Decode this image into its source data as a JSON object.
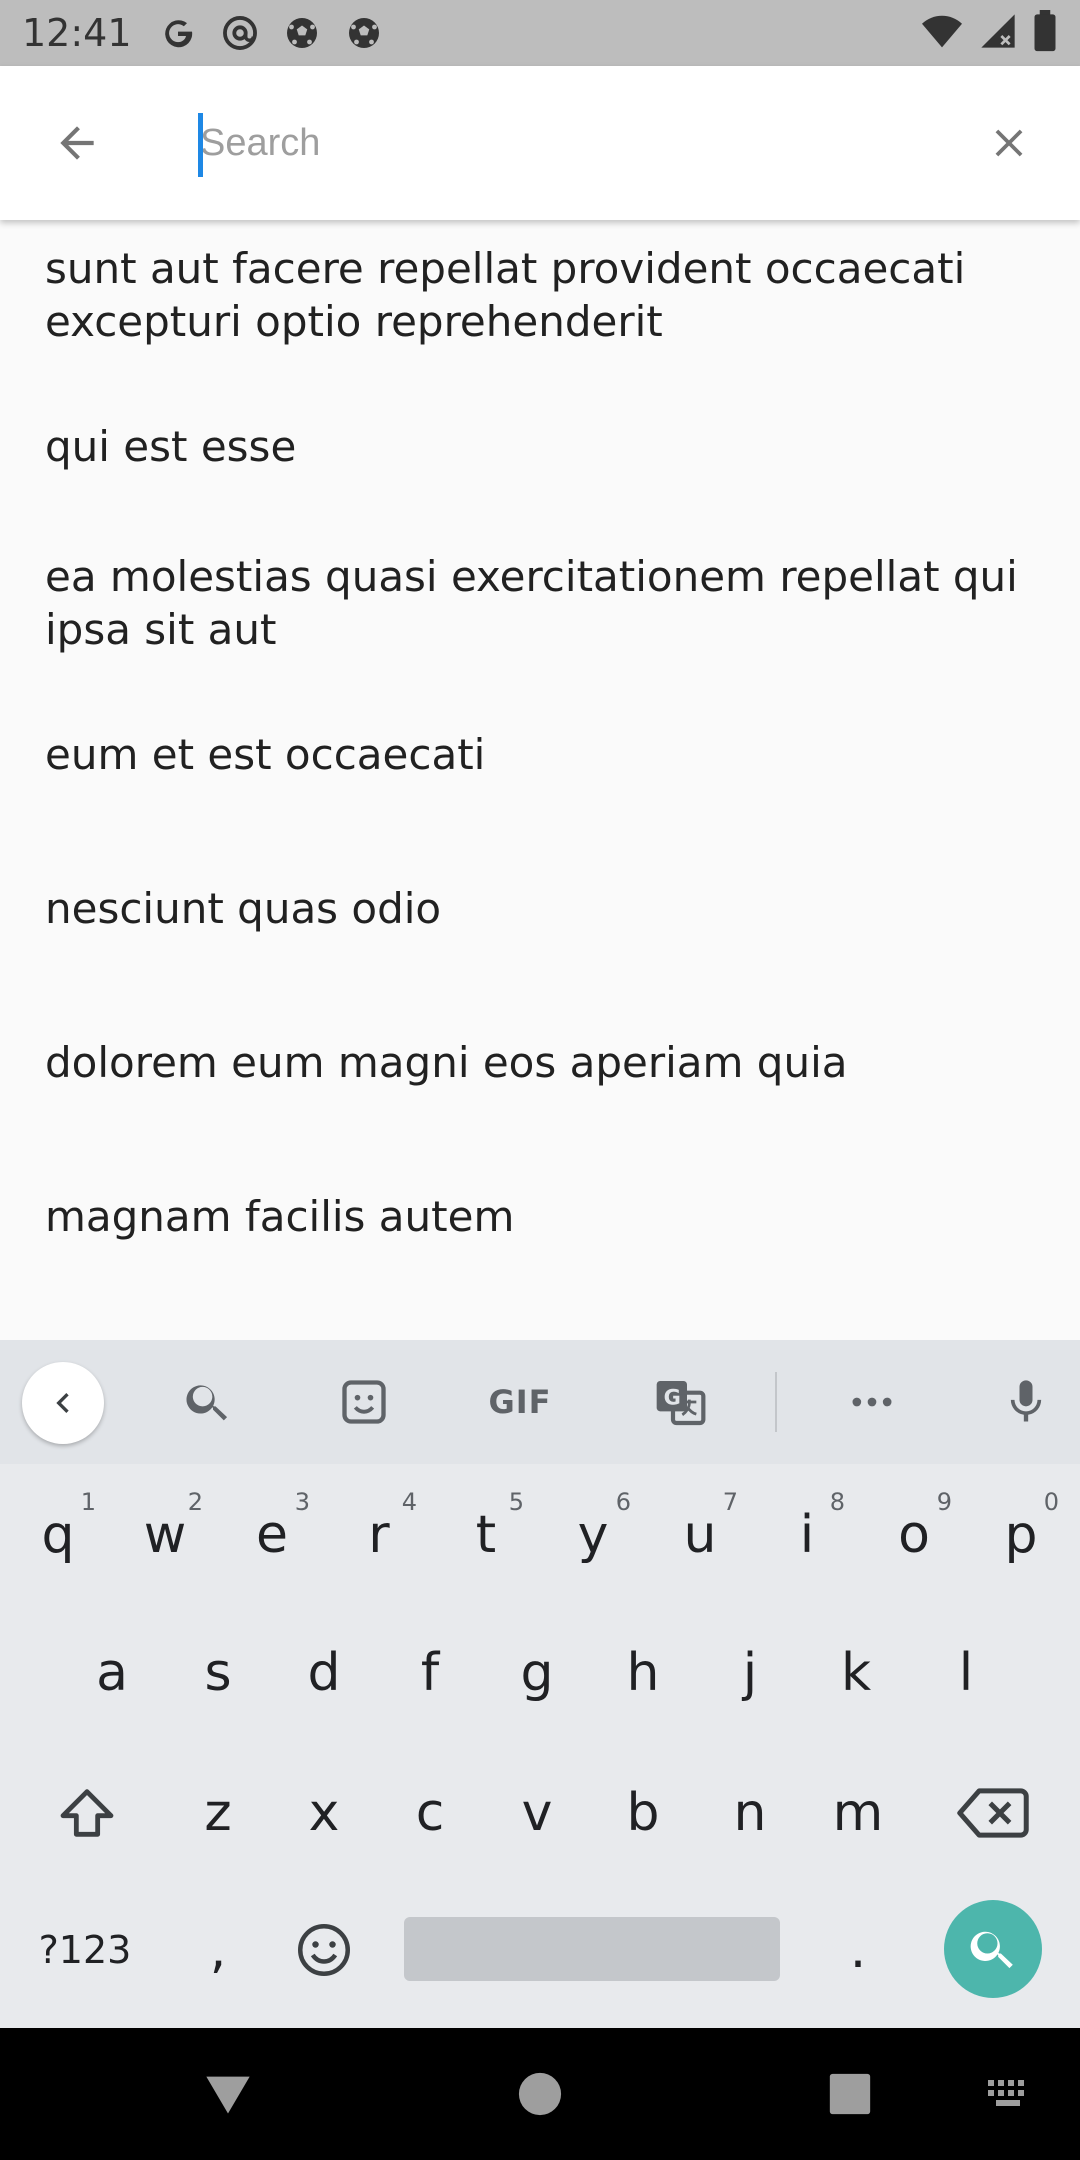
{
  "status_bar": {
    "time": "12:41",
    "left_icons": [
      "google-icon",
      "at-sign-icon",
      "soccer-ball-icon",
      "soccer-ball-icon"
    ],
    "right_icons": [
      "wifi-icon",
      "signal-icon",
      "battery-icon"
    ]
  },
  "search": {
    "placeholder": "Search",
    "value": ""
  },
  "results": [
    "sunt aut facere repellat provident occaecati excepturi optio reprehenderit",
    "qui est esse",
    "ea molestias quasi exercitationem repellat qui ipsa sit aut",
    "eum et est occaecati",
    "nesciunt quas odio",
    "dolorem eum magni eos aperiam quia",
    "magnam facilis autem"
  ],
  "keyboard": {
    "toolbar": {
      "gif_label": "GIF"
    },
    "row1": [
      {
        "key": "q",
        "hint": "1"
      },
      {
        "key": "w",
        "hint": "2"
      },
      {
        "key": "e",
        "hint": "3"
      },
      {
        "key": "r",
        "hint": "4"
      },
      {
        "key": "t",
        "hint": "5"
      },
      {
        "key": "y",
        "hint": "6"
      },
      {
        "key": "u",
        "hint": "7"
      },
      {
        "key": "i",
        "hint": "8"
      },
      {
        "key": "o",
        "hint": "9"
      },
      {
        "key": "p",
        "hint": "0"
      }
    ],
    "row2": [
      "a",
      "s",
      "d",
      "f",
      "g",
      "h",
      "j",
      "k",
      "l"
    ],
    "row3": [
      "z",
      "x",
      "c",
      "v",
      "b",
      "n",
      "m"
    ],
    "symbols_label": "?123",
    "comma": ",",
    "period": "."
  },
  "colors": {
    "accent_caret": "#1e88e5",
    "action_key": "#4db6ac"
  }
}
